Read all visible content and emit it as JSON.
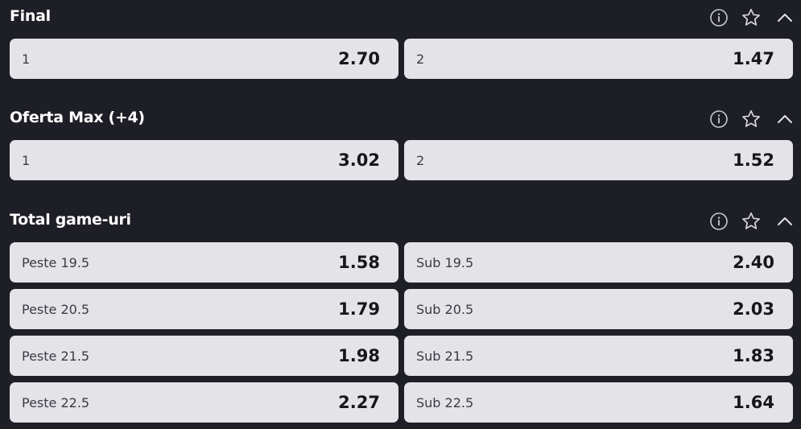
{
  "markets": [
    {
      "title": "Final",
      "rows": [
        [
          {
            "label": "1",
            "odds": "2.70"
          },
          {
            "label": "2",
            "odds": "1.47"
          }
        ]
      ]
    },
    {
      "title": "Oferta Max (+4)",
      "rows": [
        [
          {
            "label": "1",
            "odds": "3.02"
          },
          {
            "label": "2",
            "odds": "1.52"
          }
        ]
      ]
    },
    {
      "title": "Total game-uri",
      "rows": [
        [
          {
            "label": "Peste 19.5",
            "odds": "1.58"
          },
          {
            "label": "Sub 19.5",
            "odds": "2.40"
          }
        ],
        [
          {
            "label": "Peste 20.5",
            "odds": "1.79"
          },
          {
            "label": "Sub 20.5",
            "odds": "2.03"
          }
        ],
        [
          {
            "label": "Peste 21.5",
            "odds": "1.98"
          },
          {
            "label": "Sub 21.5",
            "odds": "1.83"
          }
        ],
        [
          {
            "label": "Peste 22.5",
            "odds": "2.27"
          },
          {
            "label": "Sub 22.5",
            "odds": "1.64"
          }
        ]
      ]
    }
  ],
  "icons": {
    "info": "info-icon",
    "favorite": "star-outline-icon",
    "collapse": "chevron-up-icon"
  },
  "colors": {
    "background": "#1e1e26",
    "odds_button": "#e3e3e8",
    "odds_value": "#16161c"
  }
}
